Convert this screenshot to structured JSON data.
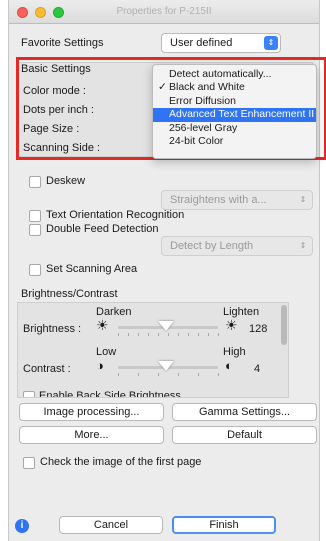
{
  "window": {
    "title": "Properties for P-215II"
  },
  "favorite": {
    "label": "Favorite Settings",
    "value": "User defined"
  },
  "basic": {
    "heading": "Basic Settings",
    "color_mode_label": "Color mode :",
    "dpi_label": "Dots per inch :",
    "page_size_label": "Page Size :",
    "scanning_side_label": "Scanning Side :"
  },
  "color_menu": {
    "items": [
      {
        "label": "Detect automatically...",
        "checked": false,
        "selected": false
      },
      {
        "label": "Black and White",
        "checked": true,
        "selected": false
      },
      {
        "label": "Error Diffusion",
        "checked": false,
        "selected": false
      },
      {
        "label": "Advanced Text Enhancement II",
        "checked": false,
        "selected": true
      },
      {
        "label": "256-level Gray",
        "checked": false,
        "selected": false
      },
      {
        "label": "24-bit Color",
        "checked": false,
        "selected": false
      }
    ],
    "check_mark": "✓"
  },
  "deskew": {
    "label": "Deskew",
    "option": "Straightens with a..."
  },
  "text_orientation": {
    "label": "Text Orientation Recognition"
  },
  "double_feed": {
    "label": "Double Feed Detection",
    "option": "Detect by Length"
  },
  "scanning_area": {
    "label": "Set Scanning Area"
  },
  "brightness_contrast": {
    "heading": "Brightness/Contrast",
    "darken": "Darken",
    "lighten": "Lighten",
    "brightness_label": "Brightness :",
    "brightness_value": "128",
    "low": "Low",
    "high": "High",
    "contrast_label": "Contrast :",
    "contrast_value": "4",
    "backside_label": "Enable Back Side Brightness"
  },
  "buttons": {
    "image_processing": "Image processing...",
    "gamma": "Gamma Settings...",
    "more": "More...",
    "default": "Default",
    "cancel": "Cancel",
    "finish": "Finish"
  },
  "first_page": {
    "label": "Check the image of the first page"
  },
  "colors": {
    "accent": "#2f74f4",
    "highlight": "#e22b27"
  }
}
